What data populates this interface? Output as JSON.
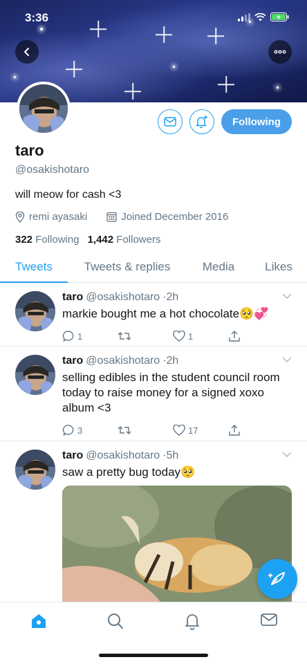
{
  "status_bar": {
    "time": "3:36"
  },
  "profile": {
    "display_name": "taro",
    "handle": "@osakishotaro",
    "bio": "will meow for cash <3",
    "location": "remi ayasaki",
    "joined": "Joined December 2016",
    "following_count": "322",
    "following_label": "Following",
    "followers_count": "1,442",
    "followers_label": "Followers",
    "follow_button_label": "Following"
  },
  "tabs": [
    {
      "label": "Tweets",
      "active": true
    },
    {
      "label": "Tweets & replies",
      "active": false
    },
    {
      "label": "Media",
      "active": false
    },
    {
      "label": "Likes",
      "active": false
    }
  ],
  "tweets": [
    {
      "name": "taro",
      "handle": "@osakishotaro",
      "time": "·2h",
      "text": "markie bought me a hot chocolate🥺💞",
      "replies": "1",
      "retweets": "",
      "likes": "1"
    },
    {
      "name": "taro",
      "handle": "@osakishotaro",
      "time": "·2h",
      "text": "selling edibles in the student council room today to raise money for a signed xoxo album <3",
      "replies": "3",
      "retweets": "",
      "likes": "17"
    },
    {
      "name": "taro",
      "handle": "@osakishotaro",
      "time": "·5h",
      "text": "saw a pretty bug today🥺"
    }
  ],
  "colors": {
    "accent": "#1da1f2",
    "follow_button": "#4a9fe8",
    "text_secondary": "#657786"
  },
  "icons": {
    "back": "chevron-left-icon",
    "more": "more-horizontal-icon",
    "message": "mail-icon",
    "notify": "bell-plus-icon",
    "location": "location-pin-icon",
    "calendar": "calendar-icon",
    "reply": "comment-icon",
    "retweet": "retweet-icon",
    "like": "heart-icon",
    "share": "share-icon",
    "compose": "compose-feather-icon",
    "nav": [
      "home-icon",
      "search-icon",
      "bell-icon",
      "mail-icon"
    ]
  }
}
